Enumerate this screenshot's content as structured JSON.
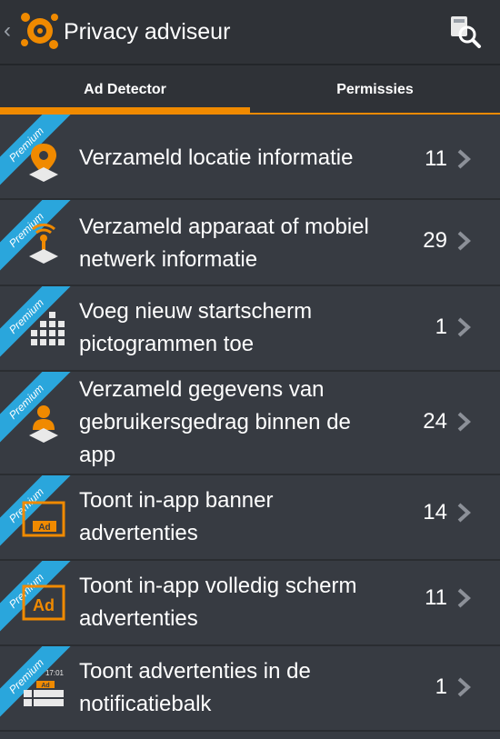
{
  "header": {
    "title": "Privacy adviseur"
  },
  "tabs": [
    {
      "label": "Ad Detector",
      "active": true
    },
    {
      "label": "Permissies",
      "active": false
    }
  ],
  "ribbon_label": "Premium",
  "colors": {
    "accent": "#f08a00",
    "ribbon": "#2aa6dc",
    "background": "#373b42"
  },
  "items": [
    {
      "label_lines": [
        "Verzameld locatie informatie"
      ],
      "count": "11",
      "icon": "location-pin-icon"
    },
    {
      "label_lines": [
        "Verzameld apparaat of mobiel",
        "netwerk informatie"
      ],
      "count": "29",
      "icon": "network-antenna-icon"
    },
    {
      "label_lines": [
        "Voeg nieuw startscherm",
        "pictogrammen toe"
      ],
      "count": "1",
      "icon": "app-grid-icon"
    },
    {
      "label_lines": [
        "Verzameld gegevens van",
        "gebruikersgedrag binnen de",
        "app"
      ],
      "count": "24",
      "icon": "user-icon"
    },
    {
      "label_lines": [
        "Toont in-app banner",
        "advertenties"
      ],
      "count": "14",
      "icon": "ad-banner-icon"
    },
    {
      "label_lines": [
        "Toont in-app volledig scherm",
        "advertenties"
      ],
      "count": "11",
      "icon": "ad-fullscreen-icon"
    },
    {
      "label_lines": [
        "Toont advertenties in de",
        "notificatiebalk"
      ],
      "count": "1",
      "icon": "notification-bar-icon"
    }
  ],
  "icon_text": {
    "ad": "Ad",
    "time": "17:01"
  }
}
